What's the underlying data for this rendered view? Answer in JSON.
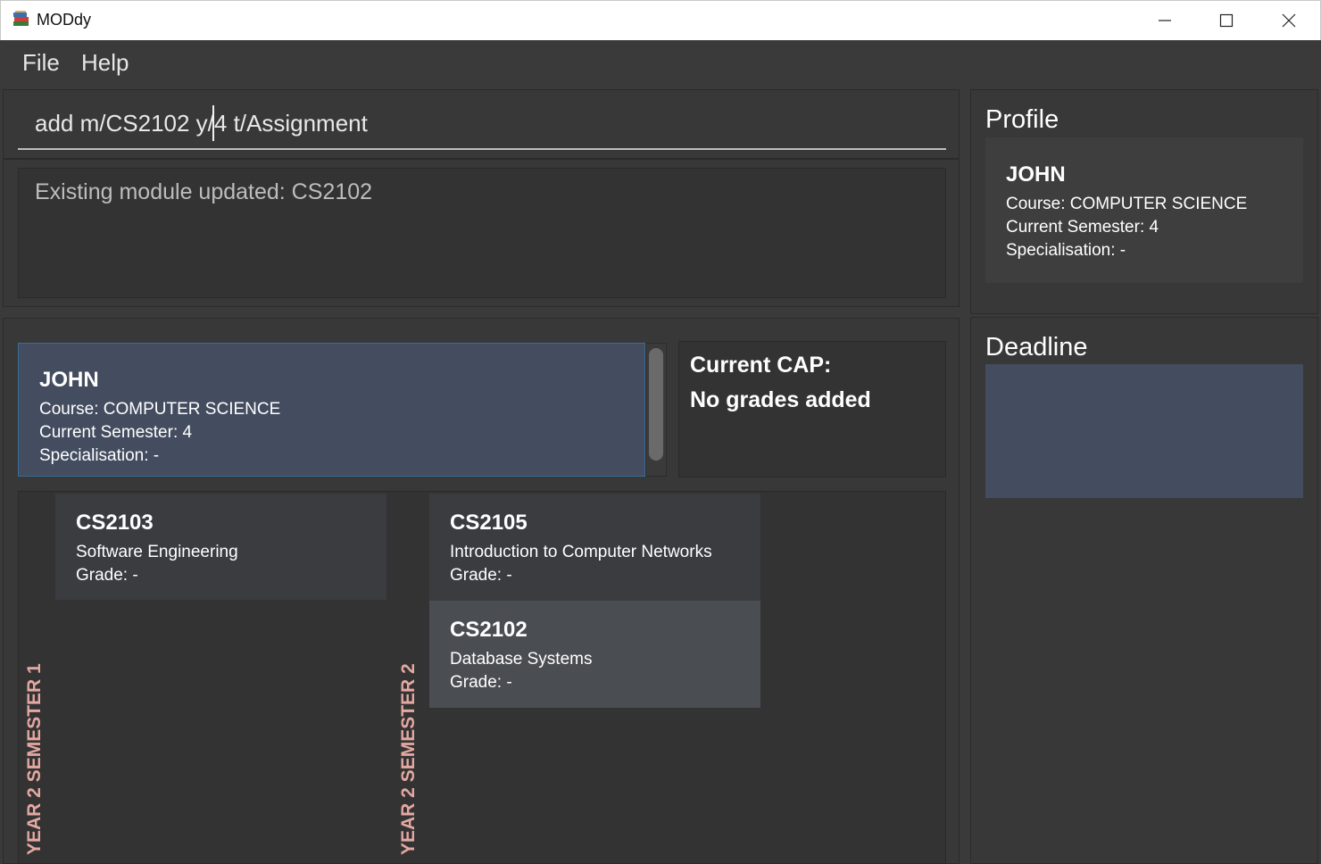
{
  "window": {
    "title": "MODdy"
  },
  "menu": {
    "items": [
      "File",
      "Help"
    ]
  },
  "command": {
    "value": "add m/CS2102 y/4 t/Assignment"
  },
  "result": {
    "message": "Existing module updated: CS2102"
  },
  "profile_card": {
    "name": "JOHN",
    "course": "Course: COMPUTER SCIENCE",
    "semester": "Current Semester: 4",
    "specialisation": "Specialisation: -"
  },
  "cap": {
    "label": "Current CAP:",
    "value": "No grades added"
  },
  "semesters": [
    {
      "label": "YEAR 2 SEMESTER 1",
      "modules": [
        {
          "code": "CS2103",
          "title": "Software Engineering",
          "grade": "Grade: -"
        }
      ]
    },
    {
      "label": "YEAR 2 SEMESTER 2",
      "modules": [
        {
          "code": "CS2105",
          "title": "Introduction to Computer Networks",
          "grade": "Grade: -"
        },
        {
          "code": "CS2102",
          "title": "Database Systems",
          "grade": "Grade: -"
        }
      ]
    }
  ],
  "side_profile": {
    "heading": "Profile",
    "name": "JOHN",
    "course": "Course: COMPUTER SCIENCE",
    "semester": "Current Semester: 4",
    "specialisation": "Specialisation: -"
  },
  "deadline": {
    "heading": "Deadline"
  },
  "colors": {
    "background": "#3a3a3a",
    "selected_card": "#434d5f",
    "semester_label": "#e4a8a2"
  },
  "icons": [
    "books-icon",
    "minimize-icon",
    "maximize-icon",
    "close-icon"
  ]
}
